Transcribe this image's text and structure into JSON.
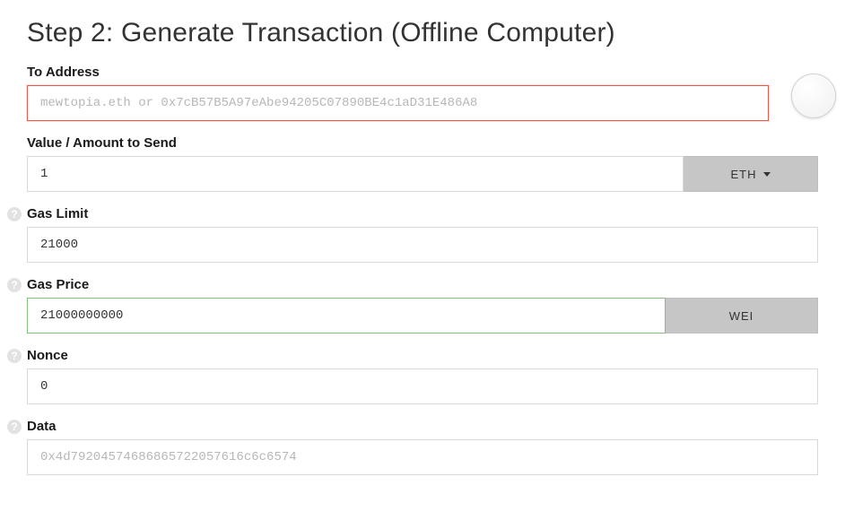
{
  "title": "Step 2: Generate Transaction (Offline Computer)",
  "fields": {
    "toAddress": {
      "label": "To Address",
      "value": "",
      "placeholder": "mewtopia.eth or 0x7cB57B5A97eAbe94205C07890BE4c1aD31E486A8"
    },
    "amount": {
      "label": "Value / Amount to Send",
      "value": "1",
      "unit": "ETH"
    },
    "gasLimit": {
      "label": "Gas Limit",
      "value": "21000"
    },
    "gasPrice": {
      "label": "Gas Price",
      "value": "21000000000",
      "unit": "WEI"
    },
    "nonce": {
      "label": "Nonce",
      "value": "0"
    },
    "data": {
      "label": "Data",
      "value": "0x4d79204574686865722057616c6c6574"
    }
  }
}
